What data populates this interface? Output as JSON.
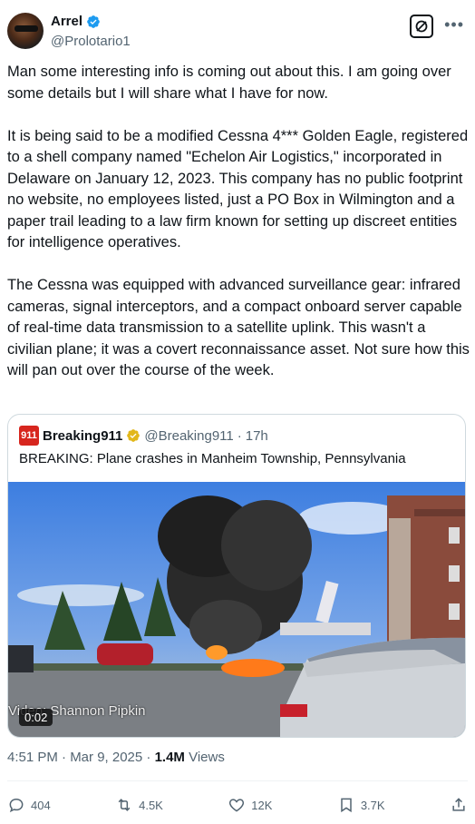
{
  "author": {
    "name": "Arrel",
    "handle": "@Prolotario1"
  },
  "tweet": {
    "paragraphs": [
      "Man some interesting info is coming out about this. I am going over some details but I will share what I have for now.",
      "It is being said to be a modified Cessna 4*** Golden Eagle, registered to a shell company named \"Echelon Air Logistics,\" incorporated in Delaware on January 12, 2023. This company has no public footprint no website, no employees listed, just a PO Box in Wilmington and a paper trail leading to a law firm known for setting up discreet entities for intelligence operatives.",
      "The Cessna was equipped with advanced surveillance gear: infrared cameras, signal interceptors, and a compact onboard server capable of real-time data transmission to a satellite uplink. This wasn't a civilian plane; it was a covert reconnaissance asset. Not sure how this will pan out over the course of the week."
    ],
    "time": "4:51 PM · Mar 9, 2025 · ",
    "views_count": "1.4M",
    "views_label": " Views"
  },
  "quote": {
    "logo_text": "911",
    "name": "Breaking911",
    "handle": "@Breaking911",
    "separator": "·",
    "age": "17h",
    "text": "BREAKING: Plane crashes in Manheim Township, Pennsylvania",
    "video_duration": "0:02",
    "video_credit": "Video: Shannon Pipkin"
  },
  "actions": {
    "replies": "404",
    "reposts": "4.5K",
    "likes": "12K",
    "bookmarks": "3.7K"
  },
  "colors": {
    "verified_blue": "#1d9bf0",
    "verified_gold": "#e2b719",
    "text_primary": "#0f1419",
    "text_muted": "#536471"
  }
}
